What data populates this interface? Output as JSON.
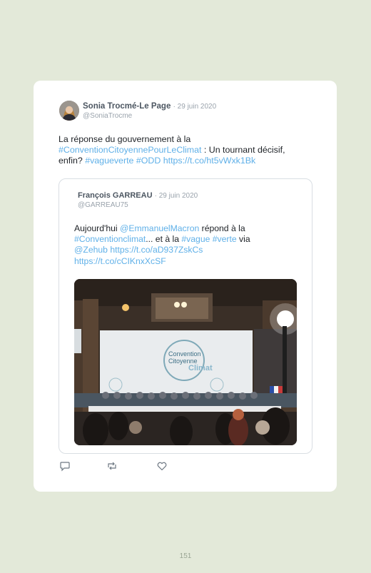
{
  "tweet": {
    "author_name": "Sonia Trocmé-Le Page",
    "date": "· 29 juin 2020",
    "handle": "@SoniaTrocme",
    "text_1": "La réponse du gouvernement à la",
    "hashtag_1": "#ConventionCitoyennePourLeClimat",
    "text_2": " : Un tournant décisif, enfin? ",
    "hashtag_2": "#vagueverte",
    "hashtag_3": "#ODD",
    "link": "https://t.co/ht5vWxk1Bk"
  },
  "quoted": {
    "author_name": "François GARREAU",
    "date": "· 29 juin 2020",
    "handle": "@GARREAU75",
    "text_1": "Aujourd'hui ",
    "mention_1": "@EmmanuelMacron",
    "text_2": " répond à la ",
    "hashtag_1": "#Conventionclimat",
    "text_3": "... et à la ",
    "hashtag_2": "#vague",
    "hashtag_3": "#verte",
    "text_4": " via ",
    "mention_2": "@Zehub",
    "link_1": "https://t.co/aD937ZskCs",
    "link_2": "https://t.co/cCIKnxXcSF",
    "photo_banner_line1": "Convention",
    "photo_banner_line2": "Citoyenne",
    "photo_banner_line3": "Climat"
  },
  "actions": {
    "reply_icon": "reply-icon",
    "retweet_icon": "retweet-icon",
    "like_icon": "heart-icon"
  },
  "page_number": "151",
  "colors": {
    "background": "#e3e9d9",
    "card": "#ffffff",
    "link": "#5fb0e8"
  }
}
